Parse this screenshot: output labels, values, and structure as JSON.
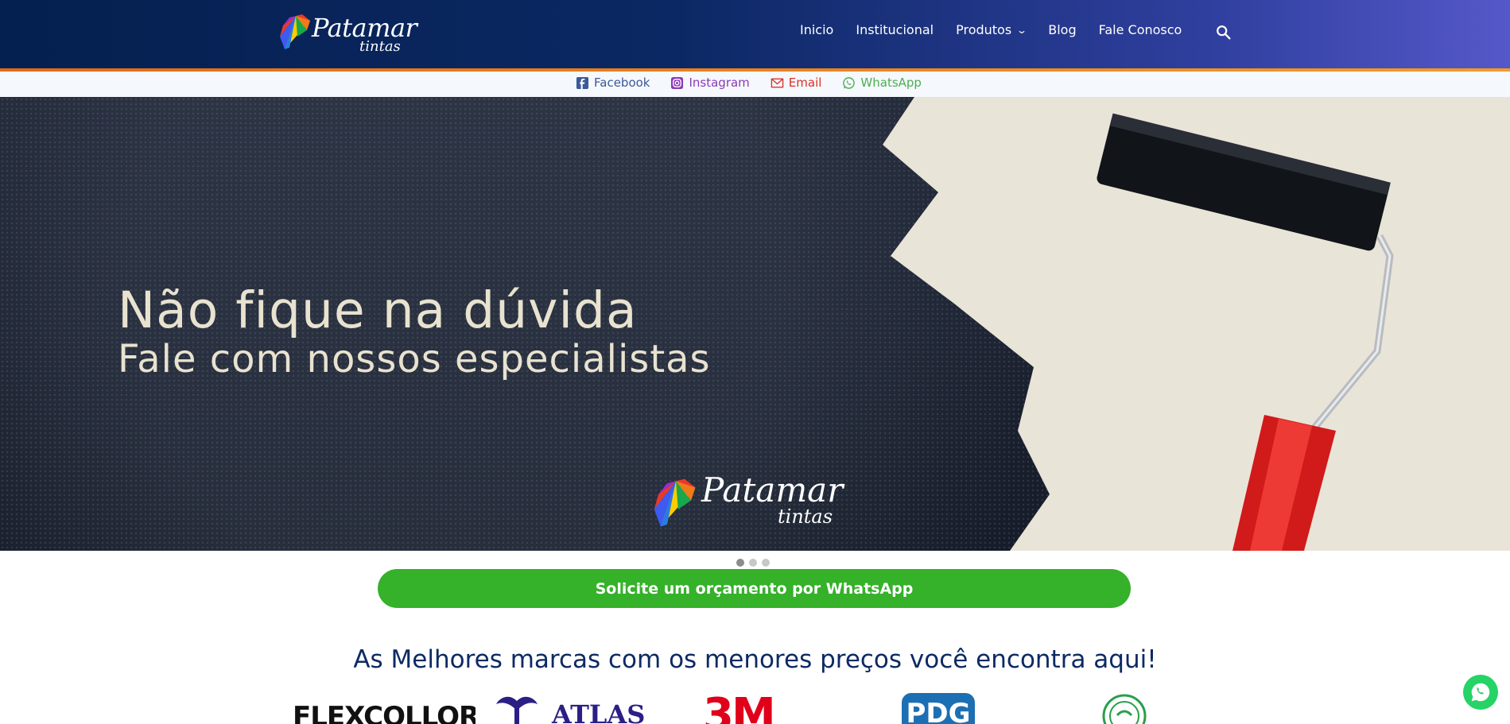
{
  "brand": {
    "name": "Patamar",
    "sub": "tintas"
  },
  "nav": {
    "items": [
      {
        "label": "Inicio"
      },
      {
        "label": "Institucional"
      },
      {
        "label": "Produtos",
        "has_dropdown": true
      },
      {
        "label": "Blog"
      },
      {
        "label": "Fale Conosco"
      }
    ],
    "search_icon": "search-icon"
  },
  "social": [
    {
      "label": "Facebook",
      "icon": "facebook-icon",
      "color": "#3b5998"
    },
    {
      "label": "Instagram",
      "icon": "instagram-icon",
      "color": "#8a3ab9"
    },
    {
      "label": "Email",
      "icon": "email-icon",
      "color": "#d93025"
    },
    {
      "label": "WhatsApp",
      "icon": "whatsapp-icon",
      "color": "#4caf50"
    }
  ],
  "hero": {
    "title_line1": "Não fique na dúvida",
    "title_line2": "Fale com nossos especialistas",
    "logo_name": "Patamar",
    "logo_sub": "tintas",
    "slides_total": 3,
    "active_slide": 1
  },
  "cta": {
    "label": "Solicite um orçamento por WhatsApp",
    "color": "#35b12a"
  },
  "brands": {
    "title": "As Melhores marcas com os menores preços você encontra aqui!",
    "items": [
      "FLEXCOLLOR",
      "ATLAS",
      "3M",
      "PDG"
    ]
  },
  "colors": {
    "header_start": "#04204f",
    "header_end": "#5558c9",
    "accent_line": "#e06a1a",
    "title": "#0d2a63"
  }
}
